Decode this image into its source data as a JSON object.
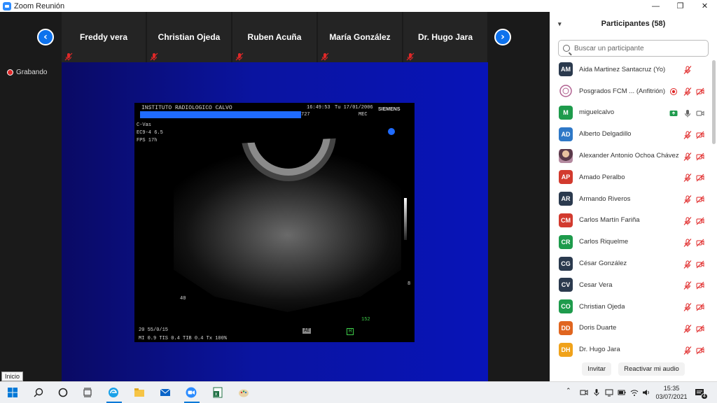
{
  "window": {
    "title": "Zoom Reunión",
    "minimize": "—",
    "maximize": "❐",
    "close": "✕"
  },
  "recording": {
    "label": "Grabando"
  },
  "gallery": {
    "prev": "‹",
    "next": "›",
    "tiles": [
      {
        "name": "Freddy vera"
      },
      {
        "name": "Christian Ojeda"
      },
      {
        "name": "Ruben Acuña"
      },
      {
        "name": "María González"
      },
      {
        "name": "Dr. Hugo Jara"
      }
    ]
  },
  "ultrasound": {
    "institute": "INSTITUTO RADIOLOGICO CALVO",
    "time": "16:49:53",
    "date": "Tu 17/01/2006",
    "brand": "SIEMENS",
    "frame": "727",
    "mode": "MEC",
    "params": [
      "C-Vas",
      "EC9-4  6.5",
      "FPS    17h"
    ],
    "depth": "40",
    "scale_right": "8",
    "gain": "152",
    "bottom_line1": "20  55/0/15",
    "bottom_line2": "MI 0.9   TIS 0.4   TIB 0.4   Tx    100%",
    "ae_label": "AE",
    "h_label": "H"
  },
  "panel": {
    "title": "Participantes (58)",
    "search_placeholder": "Buscar un participante",
    "participants": [
      {
        "initials": "AM",
        "color": "#2b3a4e",
        "name": "Aida Martinez Santacruz (Yo)",
        "mic": "muted",
        "video": "none",
        "avatar": "initials"
      },
      {
        "initials": "",
        "color": "#ffffff",
        "name": "Posgrados FCM ... (Anfitrión)",
        "mic": "muted",
        "video": "off",
        "avatar": "logo",
        "rec": true
      },
      {
        "initials": "M",
        "color": "#1e9b4c",
        "name": "miguelcalvo",
        "mic": "on",
        "video": "on",
        "avatar": "initials",
        "share": true
      },
      {
        "initials": "AD",
        "color": "#2e78c7",
        "name": "Alberto Delgadillo",
        "mic": "muted",
        "video": "off",
        "avatar": "initials"
      },
      {
        "initials": "",
        "color": "#8b5a7a",
        "name": "Alexander Antonio Ochoa Chávez",
        "mic": "muted",
        "video": "off",
        "avatar": "photo"
      },
      {
        "initials": "AP",
        "color": "#d23a2e",
        "name": "Amado Peralbo",
        "mic": "muted",
        "video": "off",
        "avatar": "initials"
      },
      {
        "initials": "AR",
        "color": "#2b3a4e",
        "name": "Armando Riveros",
        "mic": "muted",
        "video": "off",
        "avatar": "initials"
      },
      {
        "initials": "CM",
        "color": "#d23a2e",
        "name": "Carlos Martín Fariña",
        "mic": "muted",
        "video": "off",
        "avatar": "initials"
      },
      {
        "initials": "CR",
        "color": "#1e9b4c",
        "name": "Carlos Riquelme",
        "mic": "muted",
        "video": "off",
        "avatar": "initials"
      },
      {
        "initials": "CG",
        "color": "#2b3a4e",
        "name": "César González",
        "mic": "muted",
        "video": "off",
        "avatar": "initials"
      },
      {
        "initials": "CV",
        "color": "#2b3a4e",
        "name": "Cesar Vera",
        "mic": "muted",
        "video": "off",
        "avatar": "initials"
      },
      {
        "initials": "CO",
        "color": "#1e9b4c",
        "name": "Christian Ojeda",
        "mic": "muted",
        "video": "off",
        "avatar": "initials"
      },
      {
        "initials": "DD",
        "color": "#e0651f",
        "name": "Doris Duarte",
        "mic": "muted",
        "video": "off",
        "avatar": "initials"
      },
      {
        "initials": "DH",
        "color": "#f0a21a",
        "name": "Dr. Hugo Jara",
        "mic": "muted",
        "video": "off",
        "avatar": "initials"
      }
    ],
    "invite_label": "Invitar",
    "unmute_label": "Reactivar mi audio"
  },
  "tooltip": {
    "text": "Inicio"
  },
  "taskbar": {
    "time": "15:35",
    "date": "03/07/2021",
    "notifications": "4"
  },
  "colors": {
    "accent": "#0e72ed",
    "muted_red": "#e02828"
  }
}
